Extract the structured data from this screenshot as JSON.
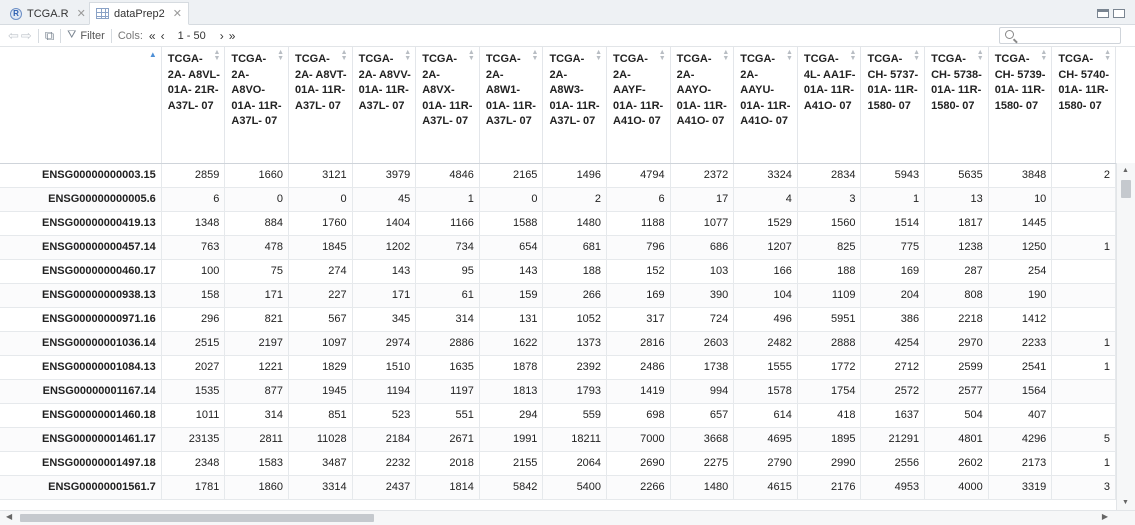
{
  "tabs": [
    {
      "label": "TCGA.R",
      "icon": "r-script-icon",
      "active": false
    },
    {
      "label": "dataPrep2",
      "icon": "data-grid-icon",
      "active": true
    }
  ],
  "toolbar": {
    "filter_label": "Filter",
    "cols_label": "Cols:",
    "cols_first": "«",
    "cols_prev": "‹",
    "cols_range": "1 - 50",
    "cols_next": "›",
    "cols_last": "»",
    "search_placeholder": ""
  },
  "table": {
    "sort_indicator": "▲",
    "columns": [
      "TCGA- 2A- A8VL- 01A- 21R- A37L- 07",
      "TCGA- 2A- A8VO- 01A- 11R- A37L- 07",
      "TCGA- 2A- A8VT- 01A- 11R- A37L- 07",
      "TCGA- 2A- A8VV- 01A- 11R- A37L- 07",
      "TCGA- 2A- A8VX- 01A- 11R- A37L- 07",
      "TCGA- 2A- A8W1- 01A- 11R- A37L- 07",
      "TCGA- 2A- A8W3- 01A- 11R- A37L- 07",
      "TCGA- 2A- AAYF- 01A- 11R- A41O- 07",
      "TCGA- 2A- AAYO- 01A- 11R- A41O- 07",
      "TCGA- 2A- AAYU- 01A- 11R- A41O- 07",
      "TCGA- 4L- AA1F- 01A- 11R- A41O- 07",
      "TCGA- CH- 5737- 01A- 11R- 1580- 07",
      "TCGA- CH- 5738- 01A- 11R- 1580- 07",
      "TCGA- CH- 5739- 01A- 11R- 1580- 07",
      "TCGA- CH- 5740- 01A- 11R- 1580- 07"
    ],
    "rows": [
      {
        "name": "ENSG00000000003.15",
        "values": [
          "2859",
          "1660",
          "3121",
          "3979",
          "4846",
          "2165",
          "1496",
          "4794",
          "2372",
          "3324",
          "2834",
          "5943",
          "5635",
          "3848",
          "2"
        ]
      },
      {
        "name": "ENSG00000000005.6",
        "values": [
          "6",
          "0",
          "0",
          "45",
          "1",
          "0",
          "2",
          "6",
          "17",
          "4",
          "3",
          "1",
          "13",
          "10",
          ""
        ]
      },
      {
        "name": "ENSG00000000419.13",
        "values": [
          "1348",
          "884",
          "1760",
          "1404",
          "1166",
          "1588",
          "1480",
          "1188",
          "1077",
          "1529",
          "1560",
          "1514",
          "1817",
          "1445",
          ""
        ]
      },
      {
        "name": "ENSG00000000457.14",
        "values": [
          "763",
          "478",
          "1845",
          "1202",
          "734",
          "654",
          "681",
          "796",
          "686",
          "1207",
          "825",
          "775",
          "1238",
          "1250",
          "1"
        ]
      },
      {
        "name": "ENSG00000000460.17",
        "values": [
          "100",
          "75",
          "274",
          "143",
          "95",
          "143",
          "188",
          "152",
          "103",
          "166",
          "188",
          "169",
          "287",
          "254",
          ""
        ]
      },
      {
        "name": "ENSG00000000938.13",
        "values": [
          "158",
          "171",
          "227",
          "171",
          "61",
          "159",
          "266",
          "169",
          "390",
          "104",
          "1109",
          "204",
          "808",
          "190",
          ""
        ]
      },
      {
        "name": "ENSG00000000971.16",
        "values": [
          "296",
          "821",
          "567",
          "345",
          "314",
          "131",
          "1052",
          "317",
          "724",
          "496",
          "5951",
          "386",
          "2218",
          "1412",
          ""
        ]
      },
      {
        "name": "ENSG00000001036.14",
        "values": [
          "2515",
          "2197",
          "1097",
          "2974",
          "2886",
          "1622",
          "1373",
          "2816",
          "2603",
          "2482",
          "2888",
          "4254",
          "2970",
          "2233",
          "1"
        ]
      },
      {
        "name": "ENSG00000001084.13",
        "values": [
          "2027",
          "1221",
          "1829",
          "1510",
          "1635",
          "1878",
          "2392",
          "2486",
          "1738",
          "1555",
          "1772",
          "2712",
          "2599",
          "2541",
          "1"
        ]
      },
      {
        "name": "ENSG00000001167.14",
        "values": [
          "1535",
          "877",
          "1945",
          "1194",
          "1197",
          "1813",
          "1793",
          "1419",
          "994",
          "1578",
          "1754",
          "2572",
          "2577",
          "1564",
          ""
        ]
      },
      {
        "name": "ENSG00000001460.18",
        "values": [
          "1011",
          "314",
          "851",
          "523",
          "551",
          "294",
          "559",
          "698",
          "657",
          "614",
          "418",
          "1637",
          "504",
          "407",
          ""
        ]
      },
      {
        "name": "ENSG00000001461.17",
        "values": [
          "23135",
          "2811",
          "11028",
          "2184",
          "2671",
          "1991",
          "18211",
          "7000",
          "3668",
          "4695",
          "1895",
          "21291",
          "4801",
          "4296",
          "5"
        ]
      },
      {
        "name": "ENSG00000001497.18",
        "values": [
          "2348",
          "1583",
          "3487",
          "2232",
          "2018",
          "2155",
          "2064",
          "2690",
          "2275",
          "2790",
          "2990",
          "2556",
          "2602",
          "2173",
          "1"
        ]
      },
      {
        "name": "ENSG00000001561.7",
        "values": [
          "1781",
          "1860",
          "3314",
          "2437",
          "1814",
          "5842",
          "5400",
          "2266",
          "1480",
          "4615",
          "2176",
          "4953",
          "4000",
          "3319",
          "3"
        ]
      }
    ]
  }
}
